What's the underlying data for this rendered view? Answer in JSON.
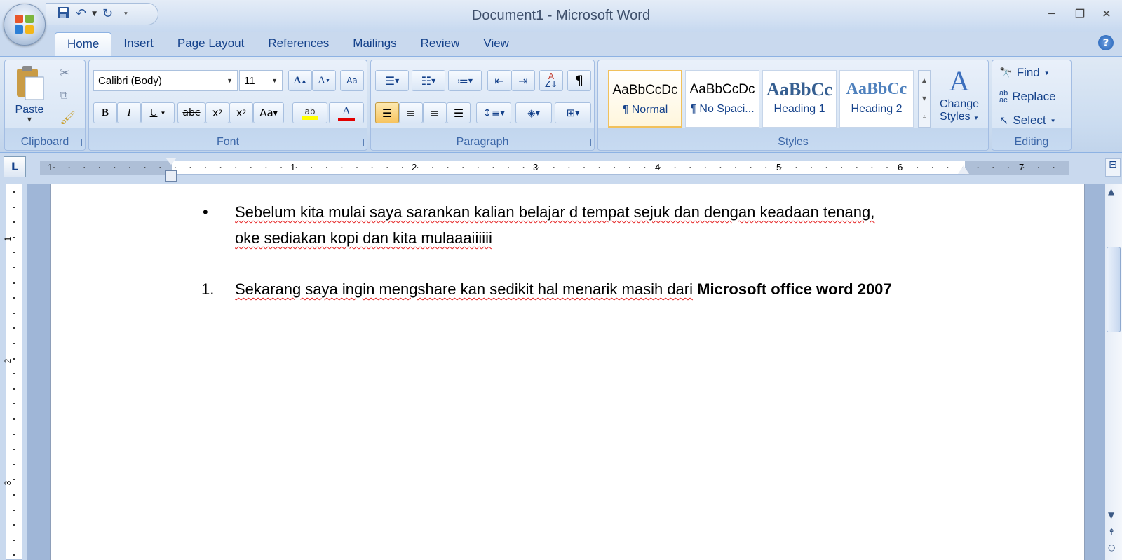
{
  "window": {
    "title": "Document1 - Microsoft Word"
  },
  "qat": {
    "save_icon": "save-icon",
    "undo_icon": "undo-icon",
    "redo_icon": "redo-icon",
    "customize_icon": "customize-qat-icon"
  },
  "tabs": [
    {
      "label": "Home",
      "active": true
    },
    {
      "label": "Insert"
    },
    {
      "label": "Page Layout"
    },
    {
      "label": "References"
    },
    {
      "label": "Mailings"
    },
    {
      "label": "Review"
    },
    {
      "label": "View"
    }
  ],
  "clipboard": {
    "paste_label": "Paste",
    "group_label": "Clipboard"
  },
  "font": {
    "family": "Calibri (Body)",
    "size": "11",
    "group_label": "Font"
  },
  "paragraph": {
    "group_label": "Paragraph"
  },
  "styles": {
    "group_label": "Styles",
    "items": [
      {
        "preview": "AaBbCcDc",
        "name": "¶ Normal",
        "selected": true
      },
      {
        "preview": "AaBbCcDc",
        "name": "¶ No Spaci..."
      },
      {
        "preview": "AaBbCc",
        "name": "Heading 1"
      },
      {
        "preview": "AaBbCc",
        "name": "Heading 2"
      }
    ],
    "change_styles_line1": "Change",
    "change_styles_line2": "Styles"
  },
  "editing": {
    "find": "Find",
    "replace": "Replace",
    "select": "Select",
    "group_label": "Editing"
  },
  "ruler": {
    "h_numbers": [
      "1",
      "1",
      "2",
      "3",
      "4",
      "5",
      "6",
      "7"
    ],
    "v_numbers": [
      "1",
      "2",
      "3"
    ]
  },
  "document": {
    "bullet_marker": "•",
    "bullet_line1": "Sebelum kita mulai saya sarankan kalian belajar d tempat sejuk dan dengan keadaan tenang,",
    "bullet_line2": "oke sediakan kopi dan kita mulaaaiiiiii",
    "numbered_marker": "1.",
    "numbered_text": "Sekarang saya ingin mengshare kan sedikit hal menarik masih dari",
    "numbered_bold": "Microsoft office word 2007"
  }
}
